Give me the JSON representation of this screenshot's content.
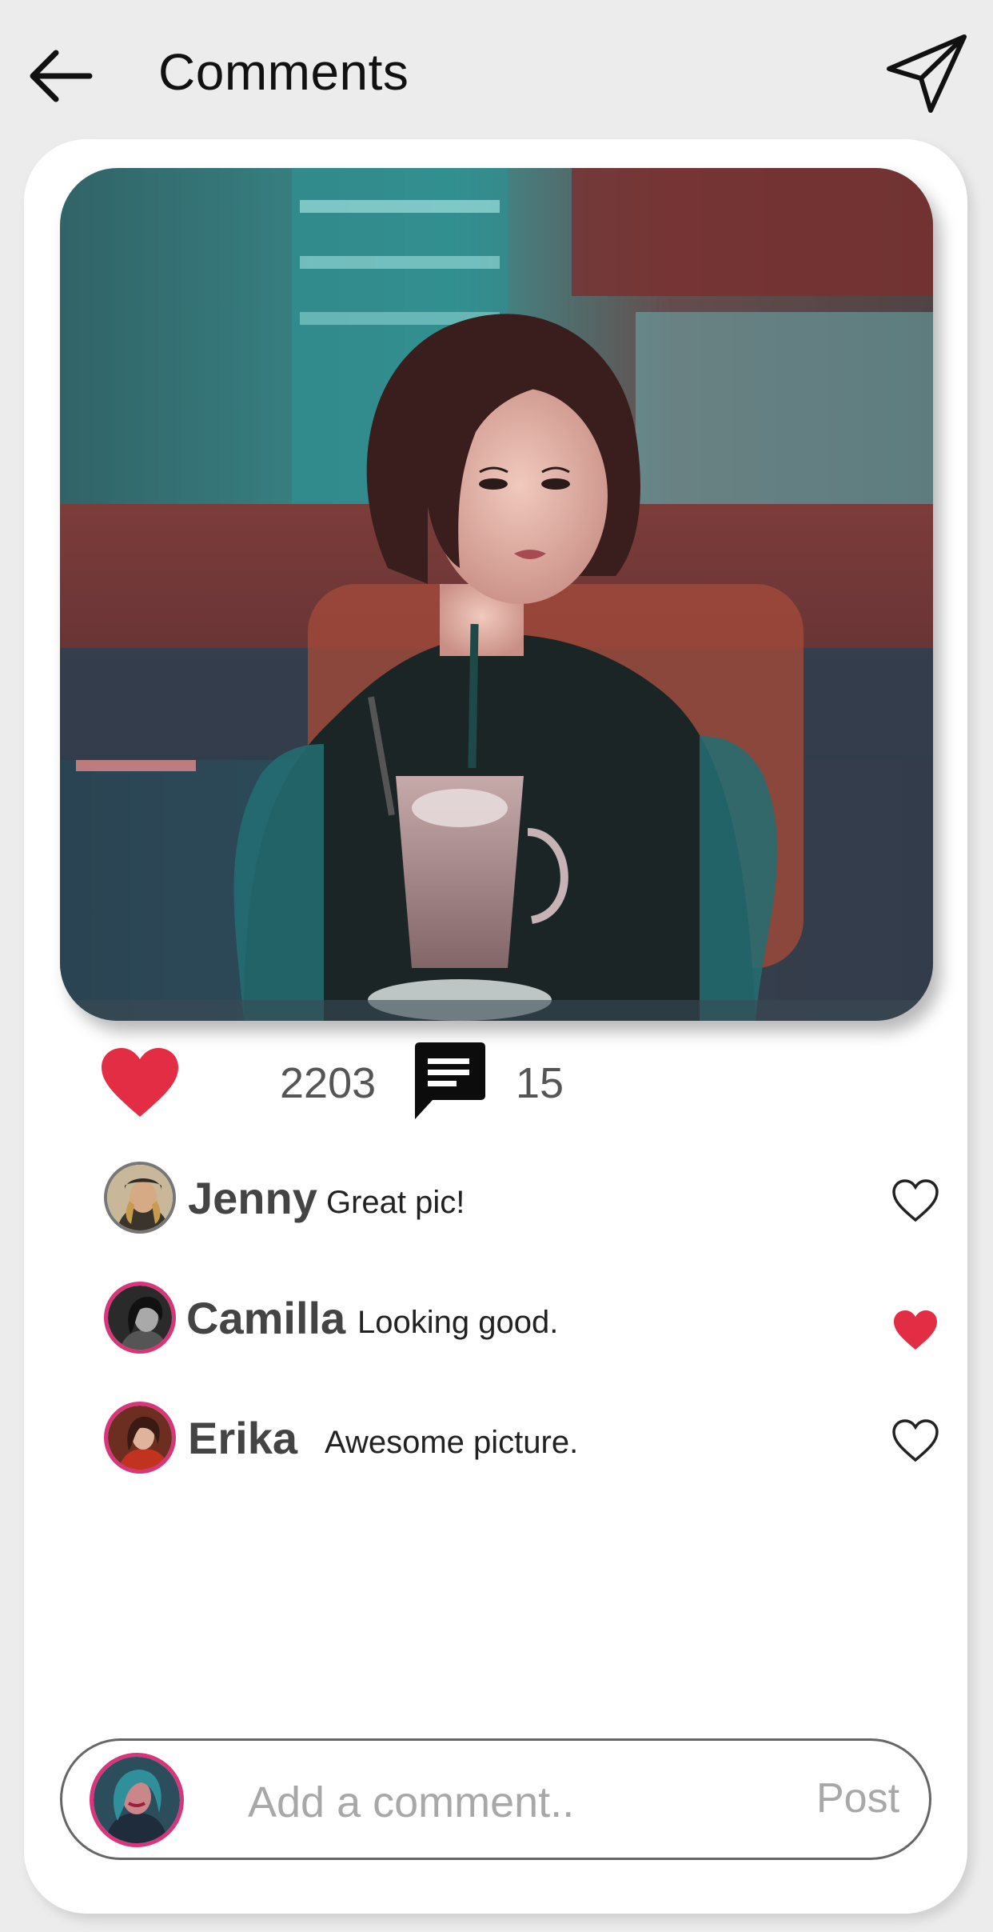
{
  "header": {
    "title": "Comments",
    "back_icon": "arrow-left-icon",
    "send_icon": "paper-plane-icon"
  },
  "post": {
    "image_alt": "Woman in black top sitting at a diner with a milkshake",
    "likes": "2203",
    "comments": "15",
    "like_icon": "heart-icon",
    "comment_icon": "speech-bubble-icon"
  },
  "comments": [
    {
      "name": "Jenny",
      "text": "Great pic!",
      "liked": false
    },
    {
      "name": "Camilla",
      "text": "Looking good.",
      "liked": true
    },
    {
      "name": "Erika",
      "text": "Awesome picture.",
      "liked": false
    }
  ],
  "composer": {
    "placeholder": "Add a comment..",
    "post_label": "Post"
  },
  "colors": {
    "accent_red": "#e32d45",
    "avatar_ring": "#d8357a",
    "muted_text": "#a8a8a8",
    "background": "#ececec"
  }
}
